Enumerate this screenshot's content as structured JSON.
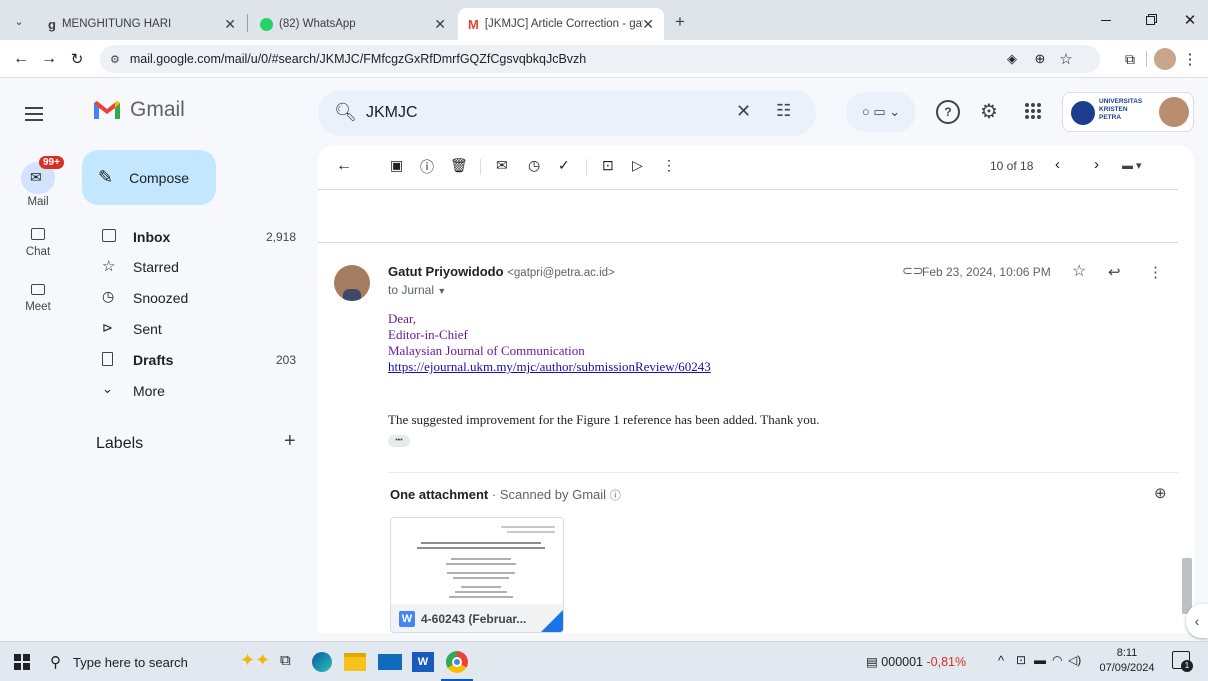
{
  "browser": {
    "tabs": [
      {
        "label": "MENGHITUNG HARI",
        "icon": "wikiversity-icon"
      },
      {
        "label": "(82) WhatsApp",
        "icon": "whatsapp-icon"
      },
      {
        "label": "[JKMJC] Article Correction - gat",
        "icon": "gmail-icon"
      }
    ],
    "url_scheme_hidden": "mail.google.com",
    "url": "mail.google.com/mail/u/0/#search/JKMJC/FMfcgzGxRfDmrfGQZfCgsvqbkqJcBvzh",
    "new_tab": "+"
  },
  "gmail": {
    "app_name": "Gmail",
    "search_value": "JKMJC",
    "compose_label": "Compose",
    "rail": {
      "mail_badge": "99+",
      "mail_label": "Mail",
      "chat_label": "Chat",
      "meet_label": "Meet"
    },
    "nav": [
      {
        "label": "Inbox",
        "count": "2,918",
        "bold": true
      },
      {
        "label": "Starred",
        "count": ""
      },
      {
        "label": "Snoozed",
        "count": ""
      },
      {
        "label": "Sent",
        "count": ""
      },
      {
        "label": "Drafts",
        "count": "203",
        "bold": true
      },
      {
        "label": "More",
        "count": ""
      }
    ],
    "labels_heading": "Labels",
    "labels_add": "+",
    "account_org": [
      "UNIVERSITAS",
      "KRISTEN",
      "PETRA"
    ],
    "pager": "10 of 18"
  },
  "message": {
    "sender_name": "Gatut Priyowidodo",
    "sender_email": "<gatpri@petra.ac.id>",
    "to_line": "to Jurnal",
    "date": "Feb 23, 2024, 10:06 PM",
    "body_lines": [
      "Dear,",
      "Editor-in-Chief",
      "Malaysian Journal of Communication"
    ],
    "link": "https://ejournal.ukm.my/mjc/author/submissionReview/60243",
    "paragraph": "The suggested improvement for the Figure 1 reference has been added. Thank you.",
    "ellipsis": "•••",
    "attachment_heading": "One attachment",
    "attachment_scan": "Scanned by Gmail",
    "attachment_name": "4-60243 (Februar..."
  },
  "taskbar": {
    "search_placeholder": "Type here to search",
    "stock_code": "000001",
    "stock_change": "-0,81%",
    "time": "8:11",
    "date": "07/09/2024",
    "notification_count": "1"
  },
  "colors": {
    "accent_blue": "#0b57d0",
    "compose_bg": "#c2e7ff",
    "body_purple": "#6a1b9a",
    "link_blue": "#1a0dab",
    "stock_red": "#d93025"
  }
}
